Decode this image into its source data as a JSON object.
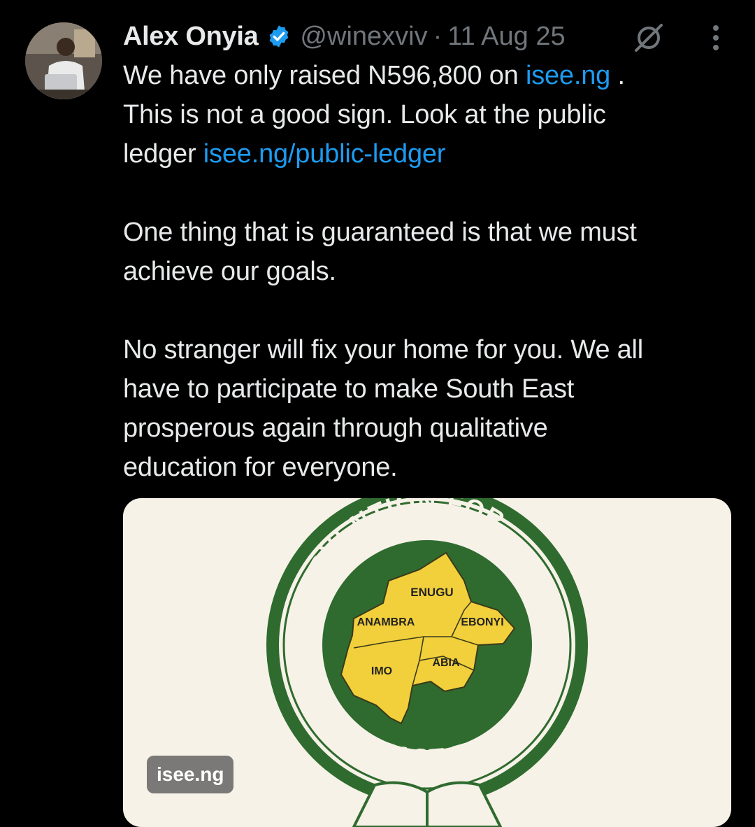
{
  "author": {
    "name": "Alex Onyia",
    "handle": "@winexviv",
    "separator": "·",
    "date": "11 Aug 25"
  },
  "icons": {
    "verified": "verified-badge-icon",
    "grok": "grok-icon",
    "more": "more-options-icon"
  },
  "colors": {
    "background": "#000000",
    "text": "#e7e9ea",
    "muted": "#71767b",
    "link": "#1d9bf0",
    "verified": "#1d9bf0",
    "logo_green": "#2f6b2f",
    "logo_yellow": "#f2d03c"
  },
  "tweet": {
    "p1_a": "We have only raised N596,800 on ",
    "p1_link1": "isee.ng",
    "p1_b": " .\nThis is not a good sign. Look at the public\nledger ",
    "p1_link2": "isee.ng/public-ledger",
    "p2": "One thing that is guaranteed is that we must\nachieve our goals.",
    "p3": "No stranger will fix your home for you. We all\nhave to participate to make South East\nprosperous again through qualitative\neducation for everyone."
  },
  "media": {
    "card_domain": "isee.ng",
    "logo_top_text": "INTERVENTION FOR",
    "logo_bottom_text": "SOUTH EAST EDUCATION",
    "states": [
      "ENUGU",
      "ANAMBRA",
      "EBONYI",
      "IMO",
      "ABIA"
    ]
  }
}
